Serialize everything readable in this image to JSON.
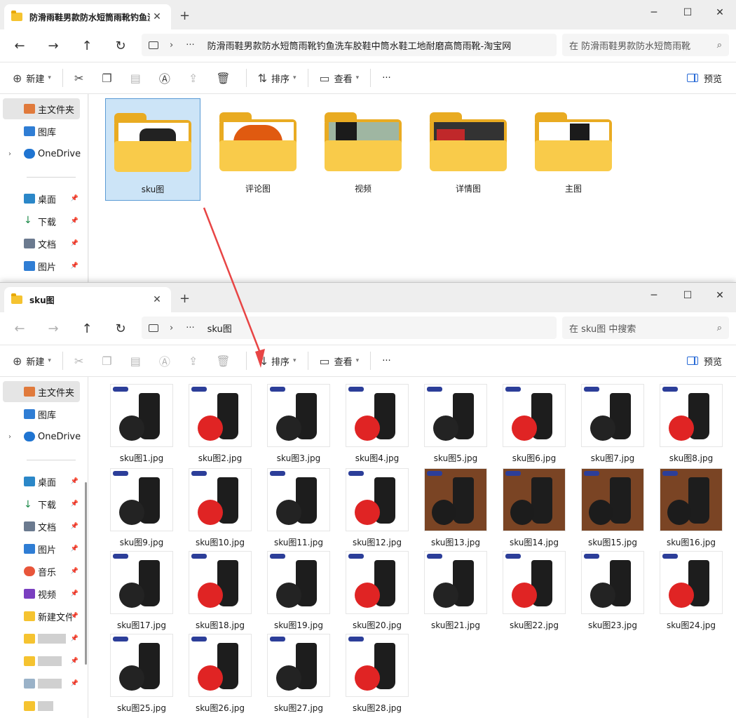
{
  "colors": {
    "accent": "#2a6bd6",
    "folder": "#f9cb4a",
    "arrow": "#e84545",
    "selection": "#cce4f7"
  },
  "window1": {
    "tab_title": "防滑雨鞋男款防水短筒雨靴钓鱼洗车胶鞋中筒水鞋工地耐磨高筒雨靴-淘宝网",
    "address": "防滑雨鞋男款防水短筒雨靴钓鱼洗车胶鞋中筒水鞋工地耐磨高筒雨靴-淘宝网",
    "search_placeholder": "在 防滑雨鞋男款防水短筒雨靴",
    "folders": [
      {
        "label": "sku图"
      },
      {
        "label": "评论图"
      },
      {
        "label": "视频"
      },
      {
        "label": "详情图"
      },
      {
        "label": "主图"
      }
    ]
  },
  "window2": {
    "tab_title": "sku图",
    "address": "sku图",
    "search_placeholder": "在 sku图 中搜索",
    "files": [
      "sku图1.jpg",
      "sku图2.jpg",
      "sku图3.jpg",
      "sku图4.jpg",
      "sku图5.jpg",
      "sku图6.jpg",
      "sku图7.jpg",
      "sku图8.jpg",
      "sku图9.jpg",
      "sku图10.jpg",
      "sku图11.jpg",
      "sku图12.jpg",
      "sku图13.jpg",
      "sku图14.jpg",
      "sku图15.jpg",
      "sku图16.jpg",
      "sku图17.jpg",
      "sku图18.jpg",
      "sku图19.jpg",
      "sku图20.jpg",
      "sku图21.jpg",
      "sku图22.jpg",
      "sku图23.jpg",
      "sku图24.jpg",
      "sku图25.jpg",
      "sku图26.jpg",
      "sku图27.jpg",
      "sku图28.jpg"
    ]
  },
  "toolbar": {
    "new": "新建",
    "sort": "排序",
    "view": "查看",
    "more": "···",
    "preview": "预览"
  },
  "sidebar": {
    "home": "主文件夹",
    "gallery": "图库",
    "onedrive": "OneDrive",
    "pinned": [
      {
        "label": "桌面"
      },
      {
        "label": "下载"
      },
      {
        "label": "文档"
      },
      {
        "label": "图片"
      },
      {
        "label": "音乐"
      },
      {
        "label": "视频"
      },
      {
        "label": "新建文件"
      }
    ]
  }
}
